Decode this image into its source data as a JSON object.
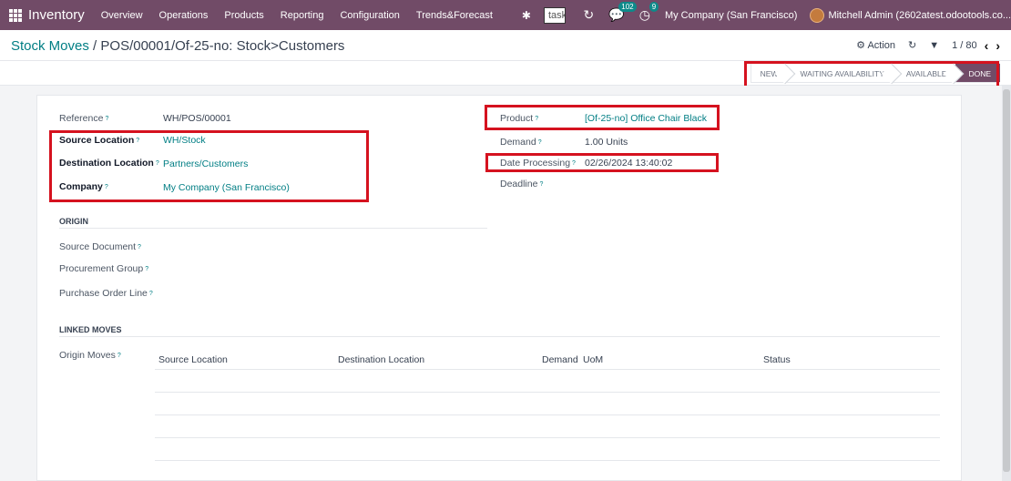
{
  "navbar": {
    "app_name": "Inventory",
    "menu": [
      "Overview",
      "Operations",
      "Products",
      "Reporting",
      "Configuration",
      "Trends&Forecast"
    ],
    "search_text": "tasks search",
    "messages_count": "102",
    "activities_count": "9",
    "company": "My Company (San Francisco)",
    "user": "Mitchell Admin (2602atest.odootools.co..."
  },
  "breadcrumb": {
    "parent": "Stock Moves",
    "separator": "/",
    "current": "POS/00001/Of-25-no: Stock>Customers"
  },
  "control": {
    "action_label": "Action",
    "pager": "1 / 80"
  },
  "status_steps": [
    {
      "label": "NEW",
      "active": false
    },
    {
      "label": "WAITING AVAILABILITY",
      "active": false
    },
    {
      "label": "AVAILABLE",
      "active": false
    },
    {
      "label": "DONE",
      "active": true
    }
  ],
  "fields_left": {
    "reference_label": "Reference",
    "reference_value": "WH/POS/00001",
    "source_location_label": "Source Location",
    "source_location_value": "WH/Stock",
    "destination_location_label": "Destination Location",
    "destination_location_value": "Partners/Customers",
    "company_label": "Company",
    "company_value": "My Company (San Francisco)"
  },
  "fields_right": {
    "product_label": "Product",
    "product_value": "[Of-25-no] Office Chair Black",
    "demand_label": "Demand",
    "demand_value": "1.00 Units",
    "date_processing_label": "Date Processing",
    "date_processing_value": "02/26/2024 13:40:02",
    "deadline_label": "Deadline"
  },
  "origin": {
    "title": "ORIGIN",
    "source_document_label": "Source Document",
    "procurement_group_label": "Procurement Group",
    "purchase_order_line_label": "Purchase Order Line"
  },
  "linked_moves": {
    "title": "LINKED MOVES",
    "origin_moves_label": "Origin Moves",
    "columns": [
      "Source Location",
      "Destination Location",
      "Demand",
      "UoM",
      "Status"
    ]
  },
  "help_mark": "?",
  "colors": {
    "brand": "#714b67",
    "link": "#017e84",
    "highlight": "#d5121f"
  }
}
